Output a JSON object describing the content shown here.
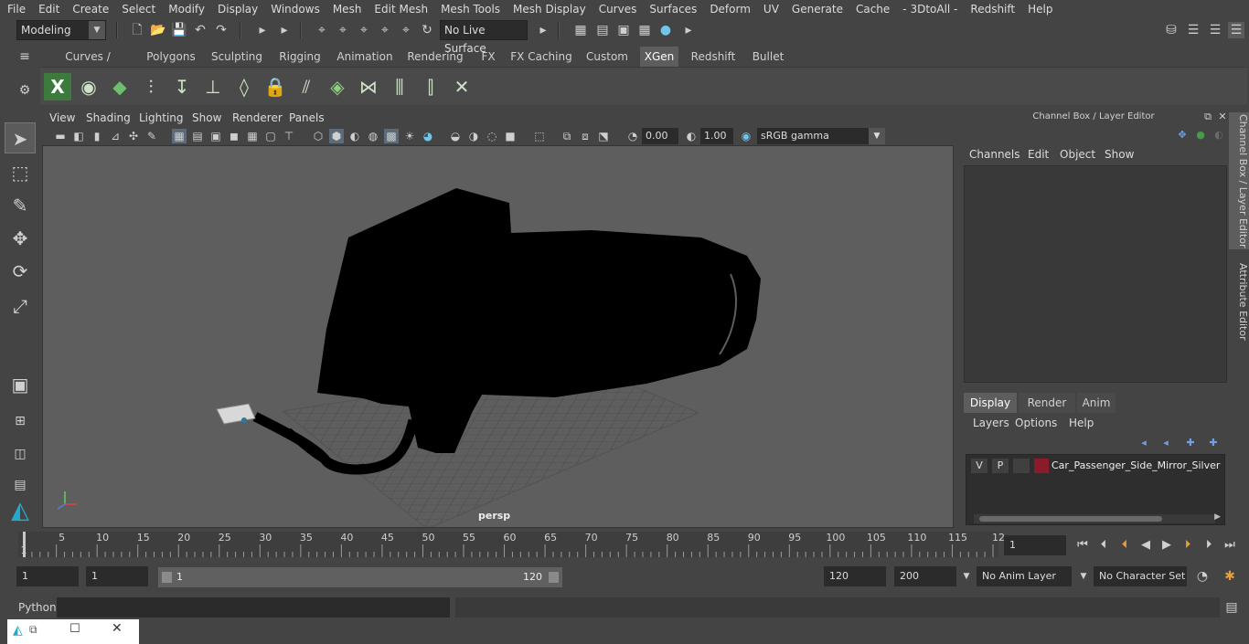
{
  "menubar": [
    "File",
    "Edit",
    "Create",
    "Select",
    "Modify",
    "Display",
    "Windows",
    "Mesh",
    "Edit Mesh",
    "Mesh Tools",
    "Mesh Display",
    "Curves",
    "Surfaces",
    "Deform",
    "UV",
    "Generate",
    "Cache",
    "- 3DtoAll -",
    "Redshift",
    "Help"
  ],
  "statusline": {
    "mode": "Modeling",
    "live_surface": "No Live Surface"
  },
  "shelf": {
    "tabs": [
      "Curves / Surfaces",
      "Polygons",
      "Sculpting",
      "Rigging",
      "Animation",
      "Rendering",
      "FX",
      "FX Caching",
      "Custom",
      "XGen",
      "Redshift",
      "Bullet"
    ],
    "active_tab": "XGen",
    "icons": [
      "xgen-editor-icon",
      "xgen-preview-icon",
      "xgen-clear-icon",
      "xgen-add-guide-icon",
      "xgen-select-guide-icon",
      "xgen-plus-guide-icon",
      "xgen-sculpt-guide-icon",
      "xgen-lock-icon",
      "xgen-guide-length-icon",
      "xgen-flatten-icon",
      "xgen-bend-icon",
      "xgen-cut-icon",
      "xgen-guide-rebuild-icon",
      "xgen-delete-icon"
    ]
  },
  "viewport": {
    "menu": [
      "View",
      "Shading",
      "Lighting",
      "Show",
      "Renderer",
      "Panels"
    ],
    "exposure": "0.00",
    "gamma": "1.00",
    "colorspace": "sRGB gamma",
    "camera": "persp",
    "bg_color": "#5e5e5e"
  },
  "channelbox": {
    "title": "Channel Box / Layer Editor",
    "menu": [
      "Channels",
      "Edit",
      "Object",
      "Show"
    ],
    "tabs": [
      "Display",
      "Render",
      "Anim"
    ],
    "active_tab": "Display",
    "layer_menu": [
      "Layers",
      "Options",
      "Help"
    ],
    "layer": {
      "v": "V",
      "p": "P",
      "name": "Car_Passenger_Side_Mirror_Silver",
      "color": "#8b1a2a"
    }
  },
  "side_tabs": [
    "Channel Box / Layer Editor",
    "Attribute Editor"
  ],
  "timeline": {
    "labels": [
      "5",
      "10",
      "15",
      "20",
      "25",
      "30",
      "35",
      "40",
      "45",
      "50",
      "55",
      "60",
      "65",
      "70",
      "75",
      "80",
      "85",
      "90",
      "95",
      "100",
      "105",
      "110",
      "115",
      "12"
    ],
    "first_label": "1",
    "current_frame": "1"
  },
  "range": {
    "start": "1",
    "anim_start": "1",
    "slider_start": "1",
    "slider_end": "120",
    "end": "120",
    "anim_end": "200",
    "anim_layer": "No Anim Layer",
    "char_set": "No Character Set"
  },
  "cmd": {
    "label": "Python"
  }
}
